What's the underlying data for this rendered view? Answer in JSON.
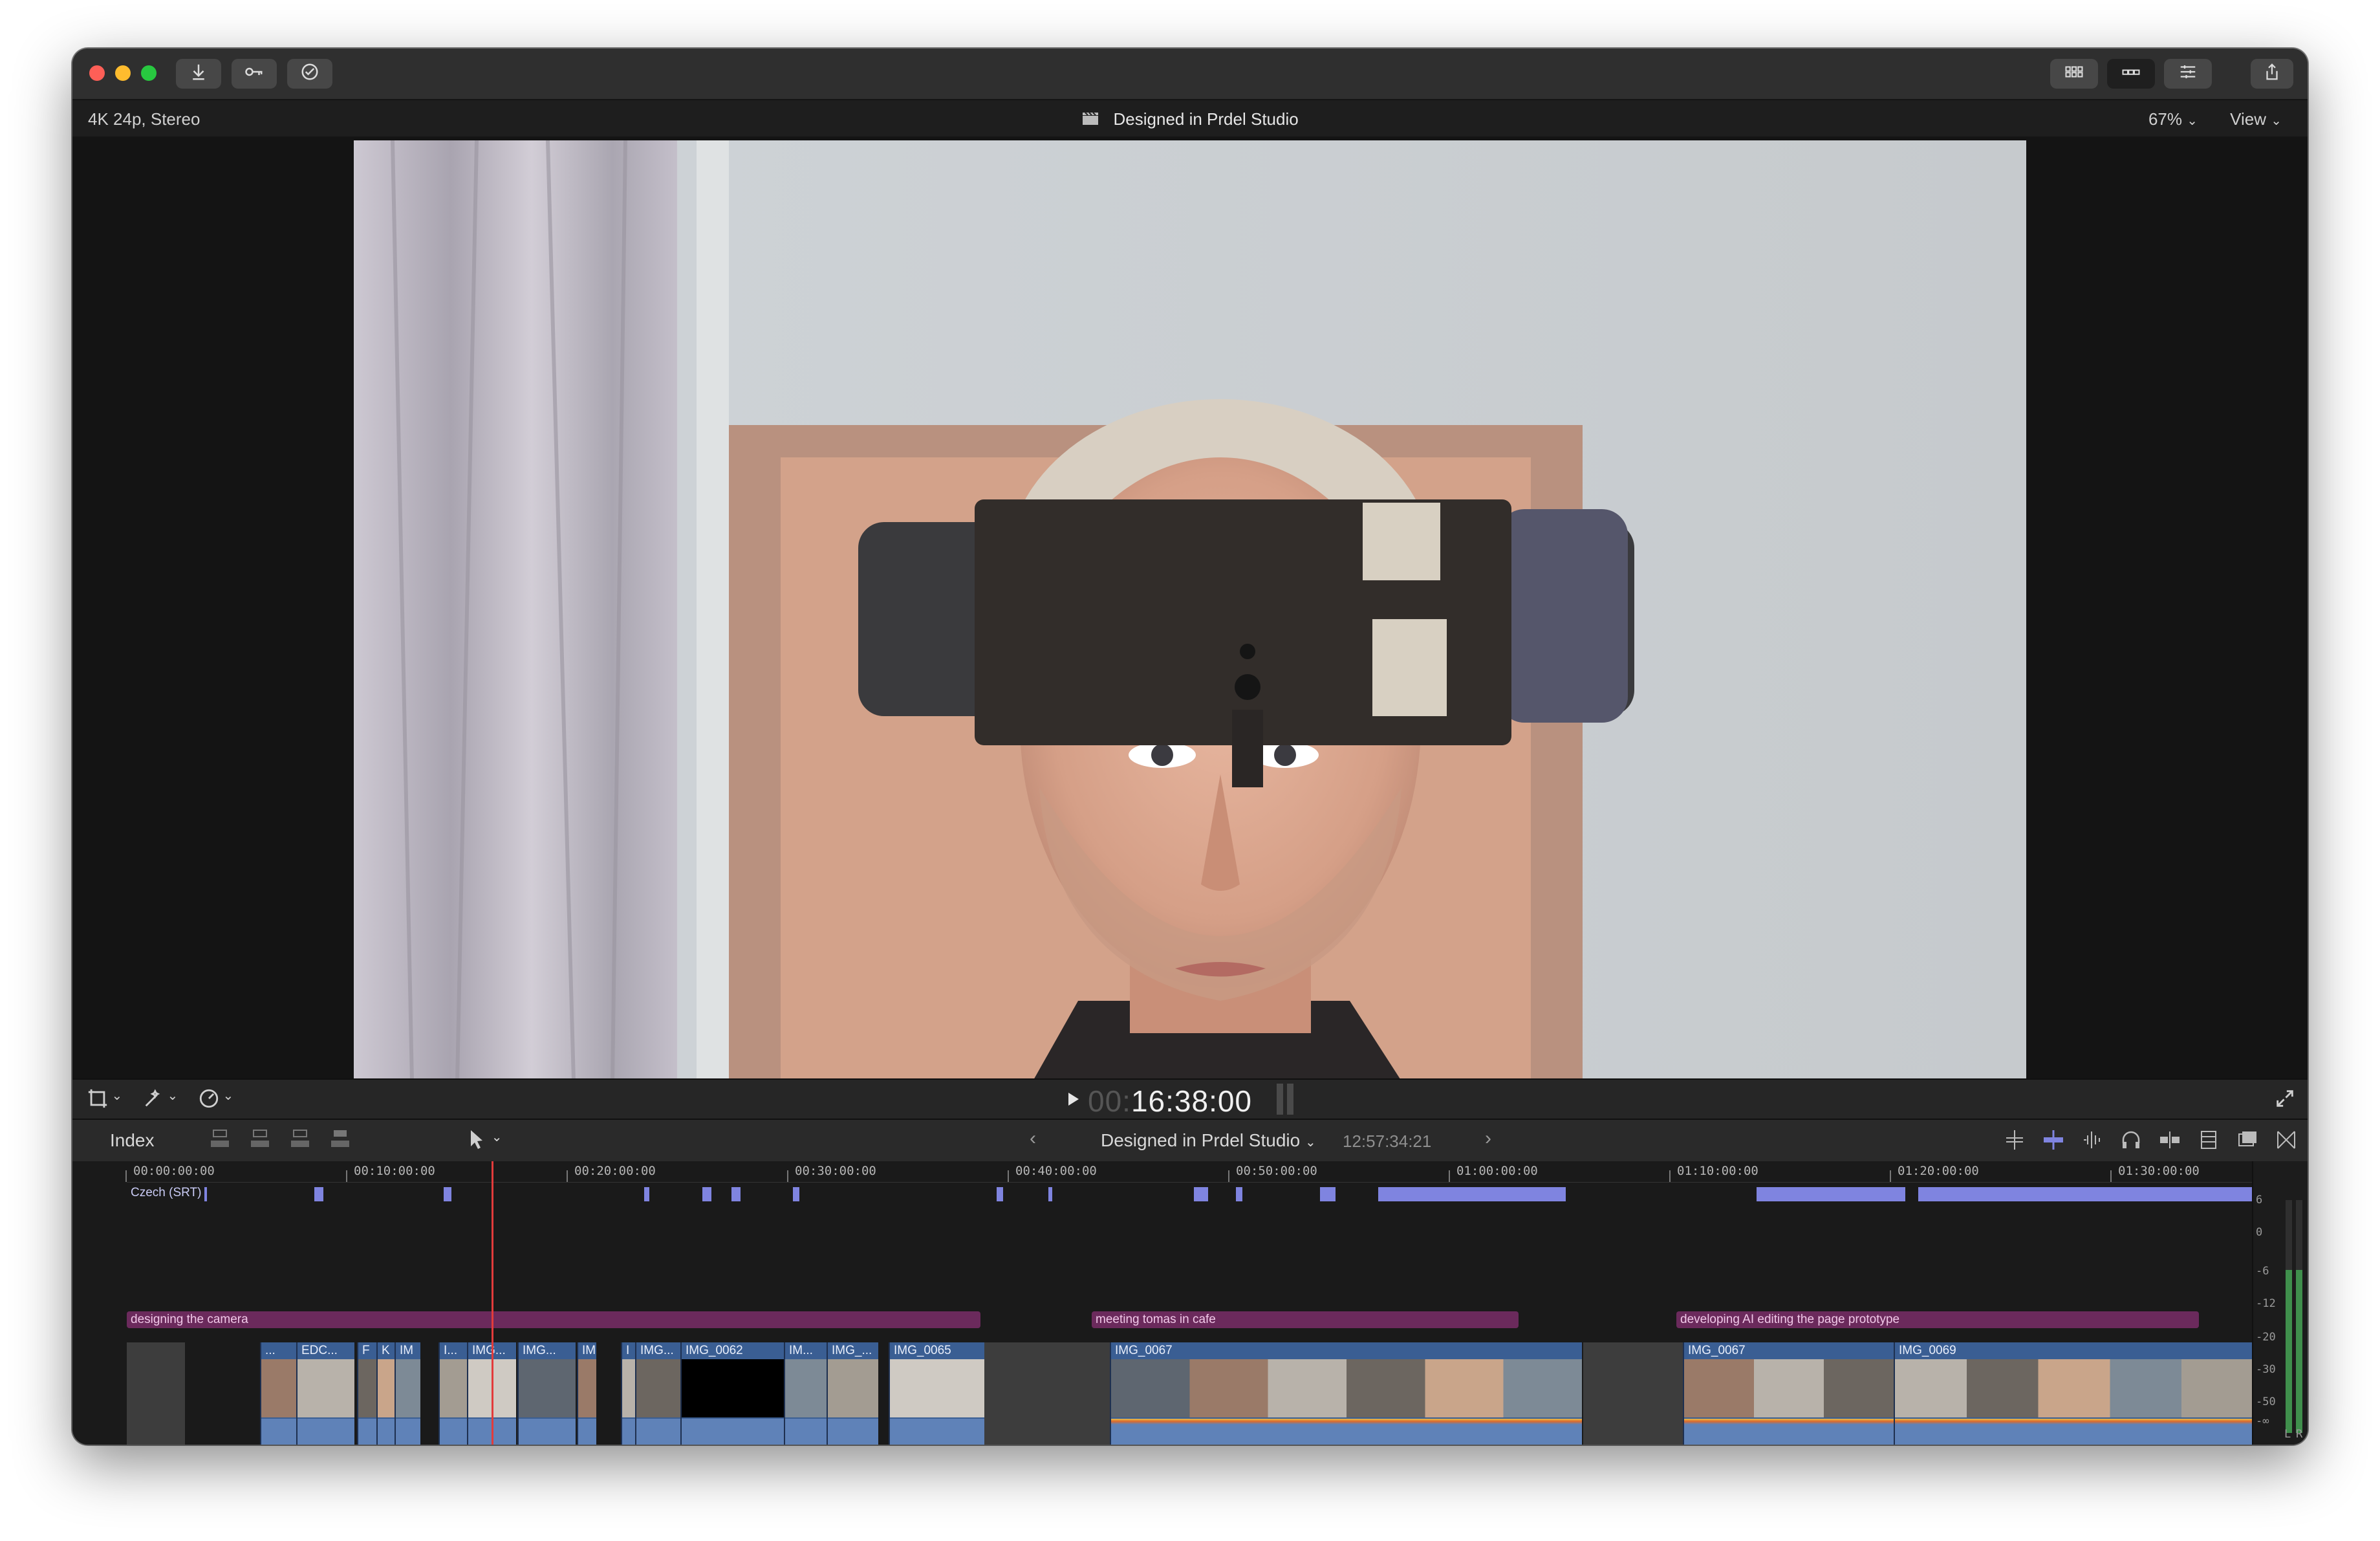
{
  "app": {
    "project_title": "Designed in Prdel Studio",
    "format": "4K 24p, Stereo",
    "zoom": "67%",
    "view_menu": "View"
  },
  "colors": {
    "traffic_close": "#fe5f57",
    "traffic_minimize": "#febc2e",
    "traffic_zoom": "#28c840",
    "clip_blue": "#3a5e93",
    "marker_purple": "#6b2a5c",
    "caption_lane": "#7f84e0",
    "playhead": "#e23b3b"
  },
  "toolbar": {
    "icons": [
      "import-icon",
      "keyword-icon",
      "checkmark-icon",
      "browser-grid-icon",
      "timeline-icon",
      "inspector-icon",
      "share-icon"
    ]
  },
  "transport": {
    "timecode_dim": "00:",
    "timecode": "16:38:00"
  },
  "timeline_header": {
    "index_label": "Index",
    "project_name": "Designed in Prdel Studio",
    "duration": "12:57:34:21"
  },
  "ruler": {
    "labels": [
      "00:00:00:00",
      "00:10:00:00",
      "00:20:00:00",
      "00:30:00:00",
      "00:40:00:00",
      "00:50:00:00",
      "01:00:00:00",
      "01:10:00:00",
      "01:20:00:00",
      "01:30:00:00"
    ]
  },
  "captions": {
    "lane_label": "Czech (SRT)"
  },
  "markers": [
    {
      "label": "designing the camera"
    },
    {
      "label": "meeting tomas in cafe"
    },
    {
      "label": "developing AI editing the page prototype"
    }
  ],
  "clips": [
    {
      "name": "..."
    },
    {
      "name": "EDC..."
    },
    {
      "name": "F"
    },
    {
      "name": "K"
    },
    {
      "name": "IM"
    },
    {
      "name": "I..."
    },
    {
      "name": "IMG..."
    },
    {
      "name": "IMG..."
    },
    {
      "name": "IM"
    },
    {
      "name": "I"
    },
    {
      "name": "IMG..."
    },
    {
      "name": "IMG_0062"
    },
    {
      "name": "IM..."
    },
    {
      "name": "IMG_..."
    },
    {
      "name": "IMG_0065"
    },
    {
      "name": "IMG_0067"
    },
    {
      "name": "IMG_0067"
    },
    {
      "name": "IMG_0069"
    }
  ],
  "meter": {
    "scale": [
      "6",
      "0",
      "-6",
      "-12",
      "-20",
      "-30",
      "-50",
      "-∞"
    ],
    "channels": [
      "L",
      "R"
    ]
  }
}
